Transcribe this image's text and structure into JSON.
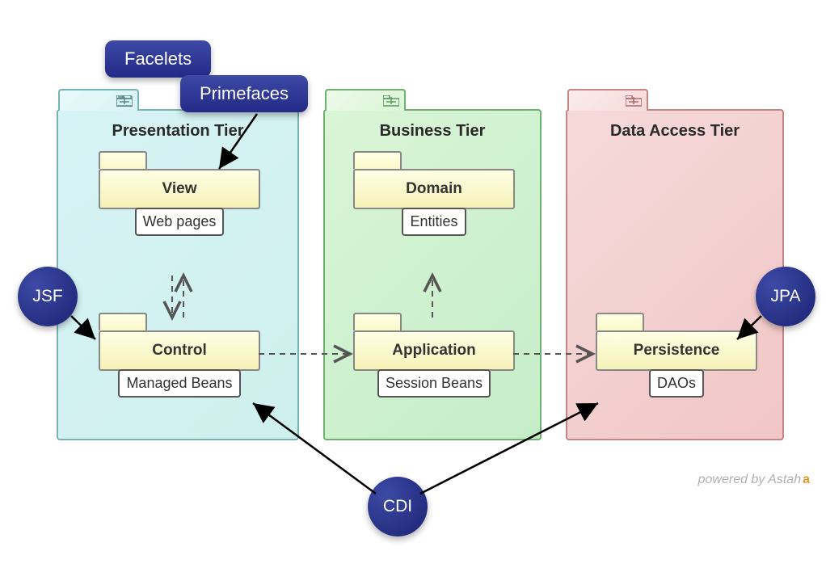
{
  "tiers": {
    "presentation": {
      "title": "Presentation Tier"
    },
    "business": {
      "title": "Business Tier"
    },
    "dataaccess": {
      "title": "Data Access Tier"
    }
  },
  "packages": {
    "view": {
      "name": "View",
      "desc": "Web pages"
    },
    "control": {
      "name": "Control",
      "desc": "Managed Beans"
    },
    "domain": {
      "name": "Domain",
      "desc": "Entities"
    },
    "application": {
      "name": "Application",
      "desc": "Session Beans"
    },
    "persistence": {
      "name": "Persistence",
      "desc": "DAOs"
    }
  },
  "annotations": {
    "facelets": "Facelets",
    "primefaces": "Primefaces",
    "jsf": "JSF",
    "cdi": "CDI",
    "jpa": "JPA"
  },
  "watermark": {
    "text": "powered by Astah",
    "icon": "a"
  }
}
